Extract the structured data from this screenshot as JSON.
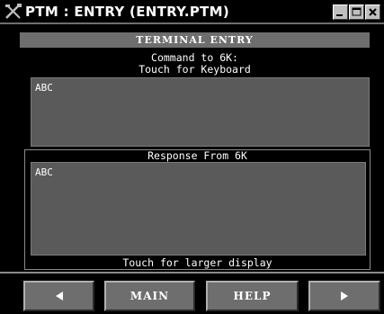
{
  "window": {
    "title": "PTM : ENTRY (ENTRY.PTM)",
    "icon": "crossed-tools-icon",
    "controls": [
      "minimize-icon",
      "maximize-icon",
      "close-icon"
    ]
  },
  "terminal": {
    "header": "TERMINAL ENTRY",
    "command_line1": "Command to 6K:",
    "command_line2": "Touch for Keyboard",
    "entry_text": "ABC"
  },
  "response": {
    "label": "Response From 6K",
    "text": "ABC",
    "footer": "Touch for larger display"
  },
  "nav": {
    "prev_icon": "left-arrow-icon",
    "main_label": "MAIN",
    "help_label": "HELP",
    "next_icon": "right-arrow-icon"
  },
  "colors": {
    "background": "#000000",
    "panel": "#5a5a5a",
    "button": "#6e6e6e",
    "text": "#ffffff"
  }
}
